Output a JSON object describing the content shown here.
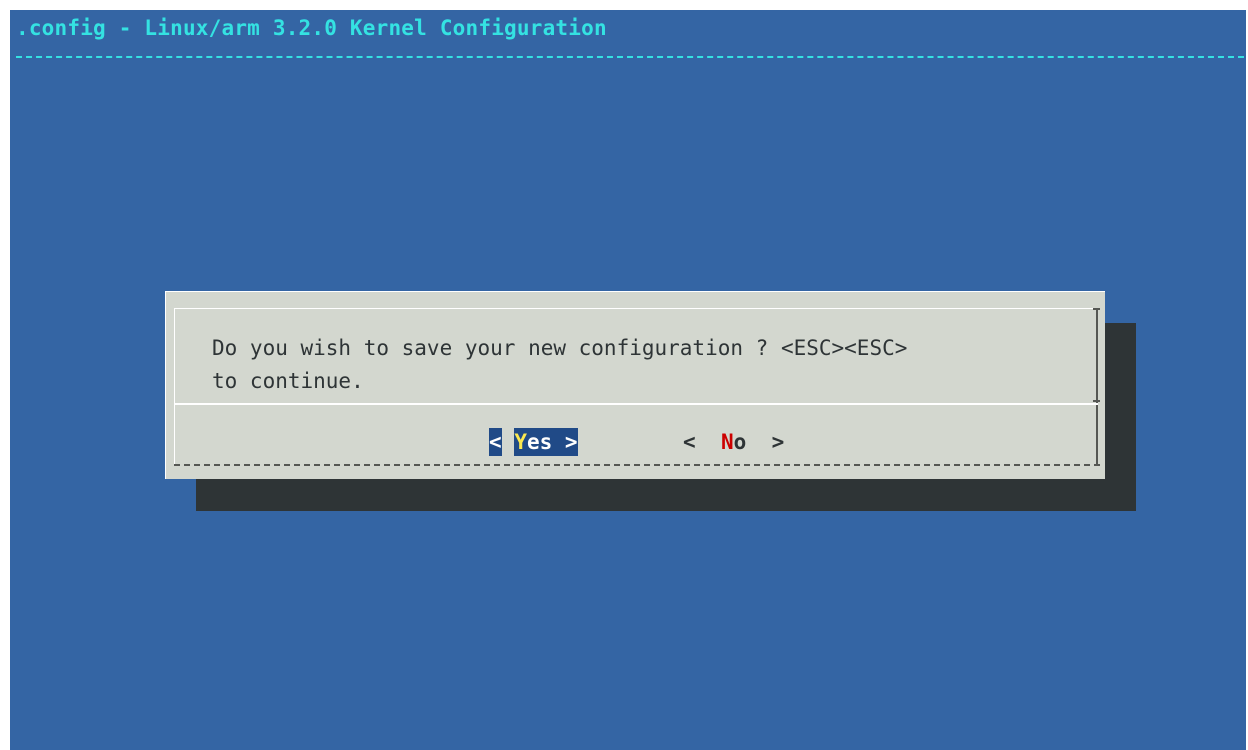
{
  "window": {
    "title": ".config - Linux/arm 3.2.0 Kernel Configuration"
  },
  "dialog": {
    "message_line1": "Do you wish to save your new configuration ? <ESC><ESC>",
    "message_line2": "to continue.",
    "buttons": [
      {
        "open": "<",
        "hotkey": "Y",
        "rest": "es",
        "close": ">",
        "selected": true
      },
      {
        "open": "<",
        "hotkey": "N",
        "rest": "o",
        "close": ">",
        "selected": false
      }
    ]
  },
  "colors": {
    "background": "#3465a4",
    "title": "#34e2e2",
    "dialog_bg": "#d3d7cf",
    "shadow": "#2e3436",
    "selected_button_bg": "#204a87",
    "selected_hotkey": "#fce94f",
    "unselected_hotkey": "#cc0000"
  }
}
